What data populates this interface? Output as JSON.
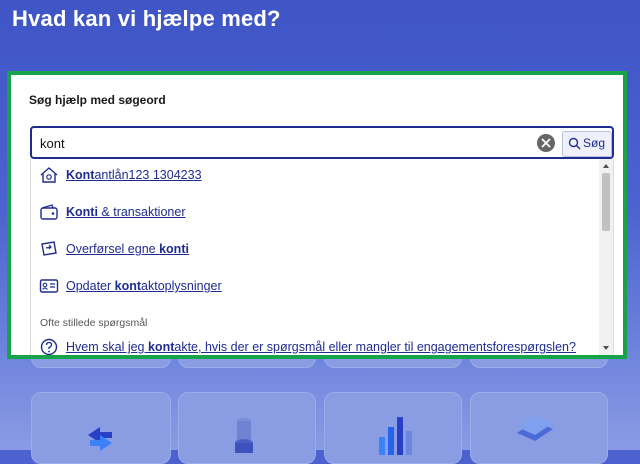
{
  "page": {
    "title": "Hvad kan vi hjælpe med?"
  },
  "search": {
    "label": "Søg hjælp med søgeord",
    "value": "kont",
    "button_label": "Søg"
  },
  "suggestions": [
    {
      "icon": "house-icon",
      "bold": "Kont",
      "rest_before": "",
      "rest": "antlån123 1304233"
    },
    {
      "icon": "wallet-icon",
      "bold": "Konti",
      "rest_before": "",
      "rest": " & transaktioner"
    },
    {
      "icon": "transfer-card-icon",
      "bold": "konti",
      "rest_before": "Overførsel egne ",
      "rest": ""
    },
    {
      "icon": "id-card-icon",
      "bold": "kont",
      "rest_before": "Opdater ",
      "rest": "aktoplysninger"
    }
  ],
  "faq": {
    "heading": "Ofte stillede spørgsmål",
    "items": [
      {
        "icon": "question-circle-icon",
        "before": "Hvem skal jeg ",
        "bold": "kont",
        "after": "akte, hvis der er spørgsmål eller mangler til engagementsforespørgslen?"
      }
    ]
  },
  "colors": {
    "accent": "#1f2c8f",
    "highlight_border": "#16a34a",
    "background": "#4c63cf"
  }
}
